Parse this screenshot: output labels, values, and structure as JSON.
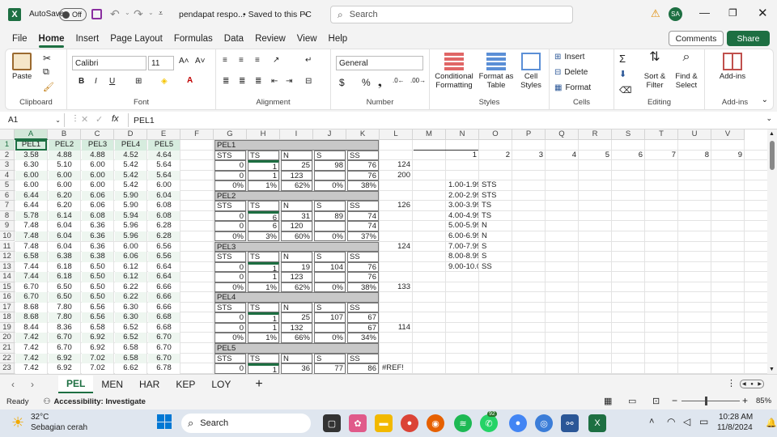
{
  "titlebar": {
    "autosave_label": "AutoSave",
    "autosave_state": "Off",
    "filename": "pendapat respo...",
    "saved_status": "• Saved to this PC",
    "search_placeholder": "Search",
    "user_initials": "SA"
  },
  "ribbon_tabs": [
    "File",
    "Home",
    "Insert",
    "Page Layout",
    "Formulas",
    "Data",
    "Review",
    "View",
    "Help"
  ],
  "ribbon_buttons": {
    "comments": "Comments",
    "share": "Share"
  },
  "ribbon": {
    "clipboard": {
      "paste": "Paste",
      "label": "Clipboard"
    },
    "font": {
      "name": "Calibri",
      "size": "11",
      "label": "Font"
    },
    "alignment": {
      "label": "Alignment"
    },
    "number": {
      "format": "General",
      "label": "Number"
    },
    "styles": {
      "cond": "Conditional Formatting",
      "table": "Format as Table",
      "cell": "Cell Styles",
      "label": "Styles"
    },
    "cells": {
      "insert": "Insert",
      "delete": "Delete",
      "format": "Format",
      "label": "Cells"
    },
    "editing": {
      "sort": "Sort & Filter",
      "find": "Find & Select",
      "label": "Editing"
    },
    "addins": {
      "btn": "Add-ins",
      "label": "Add-ins"
    }
  },
  "formula_bar": {
    "name_box": "A1",
    "fx": "fx",
    "content": "PEL1"
  },
  "columns": [
    "A",
    "B",
    "C",
    "D",
    "E",
    "F",
    "G",
    "H",
    "I",
    "J",
    "K",
    "L",
    "M",
    "N",
    "O",
    "P",
    "Q",
    "R",
    "S",
    "T",
    "U",
    "V"
  ],
  "rows": [
    "1",
    "2",
    "3",
    "4",
    "5",
    "6",
    "7",
    "8",
    "9",
    "10",
    "11",
    "12",
    "13",
    "14",
    "15",
    "16",
    "17",
    "18",
    "19",
    "20",
    "21",
    "22",
    "23"
  ],
  "table_left": {
    "headers": [
      "PEL1",
      "PEL2",
      "PEL3",
      "PEL4",
      "PEL5"
    ],
    "data": [
      [
        "3.58",
        "4.88",
        "4.88",
        "4.52",
        "4.64"
      ],
      [
        "6.30",
        "5.10",
        "6.00",
        "5.42",
        "5.64"
      ],
      [
        "6.00",
        "6.00",
        "6.00",
        "5.42",
        "5.64"
      ],
      [
        "6.00",
        "6.00",
        "6.00",
        "5.42",
        "6.00"
      ],
      [
        "6.44",
        "6.20",
        "6.06",
        "5.90",
        "6.04"
      ],
      [
        "6.44",
        "6.20",
        "6.06",
        "5.90",
        "6.08"
      ],
      [
        "5.78",
        "6.14",
        "6.08",
        "5.94",
        "6.08"
      ],
      [
        "7.48",
        "6.04",
        "6.36",
        "5.96",
        "6.28"
      ],
      [
        "7.48",
        "6.04",
        "6.36",
        "5.96",
        "6.28"
      ],
      [
        "7.48",
        "6.04",
        "6.36",
        "6.00",
        "6.56"
      ],
      [
        "6.58",
        "6.38",
        "6.38",
        "6.06",
        "6.56"
      ],
      [
        "7.44",
        "6.18",
        "6.50",
        "6.12",
        "6.64"
      ],
      [
        "7.44",
        "6.18",
        "6.50",
        "6.12",
        "6.64"
      ],
      [
        "6.70",
        "6.50",
        "6.50",
        "6.22",
        "6.66"
      ],
      [
        "6.70",
        "6.50",
        "6.50",
        "6.22",
        "6.66"
      ],
      [
        "8.68",
        "7.80",
        "6.56",
        "6.30",
        "6.66"
      ],
      [
        "8.68",
        "7.80",
        "6.56",
        "6.30",
        "6.68"
      ],
      [
        "8.44",
        "8.36",
        "6.58",
        "6.52",
        "6.68"
      ],
      [
        "7.42",
        "6.70",
        "6.92",
        "6.52",
        "6.70"
      ],
      [
        "7.42",
        "6.70",
        "6.92",
        "6.58",
        "6.70"
      ],
      [
        "7.42",
        "6.92",
        "7.02",
        "6.58",
        "6.70"
      ],
      [
        "7.42",
        "6.92",
        "7.02",
        "6.62",
        "6.78"
      ]
    ]
  },
  "blocks": [
    {
      "title": "PEL1",
      "labels": [
        "STS",
        "TS",
        "N",
        "S",
        "SS"
      ],
      "r1": [
        "0",
        "1",
        "25",
        "98",
        "76"
      ],
      "r2": [
        "0",
        "1",
        "123",
        "",
        "76"
      ],
      "pct": [
        "0%",
        "1%",
        "62%",
        "0%",
        "38%"
      ]
    },
    {
      "title": "PEL2",
      "labels": [
        "STS",
        "TS",
        "N",
        "S",
        "SS"
      ],
      "r1": [
        "0",
        "6",
        "31",
        "89",
        "74"
      ],
      "r2": [
        "0",
        "6",
        "120",
        "",
        "74"
      ],
      "pct": [
        "0%",
        "3%",
        "60%",
        "0%",
        "37%"
      ]
    },
    {
      "title": "PEL3",
      "labels": [
        "STS",
        "TS",
        "N",
        "S",
        "SS"
      ],
      "r1": [
        "0",
        "1",
        "19",
        "104",
        "76"
      ],
      "r2": [
        "0",
        "1",
        "123",
        "",
        "76"
      ],
      "pct": [
        "0%",
        "1%",
        "62%",
        "0%",
        "38%"
      ]
    },
    {
      "title": "PEL4",
      "labels": [
        "STS",
        "TS",
        "N",
        "S",
        "SS"
      ],
      "r1": [
        "0",
        "1",
        "25",
        "107",
        "67"
      ],
      "r2": [
        "0",
        "1",
        "132",
        "",
        "67"
      ],
      "pct": [
        "0%",
        "1%",
        "66%",
        "0%",
        "34%"
      ]
    },
    {
      "title": "PEL5",
      "labels": [
        "STS",
        "TS",
        "N",
        "S",
        "SS"
      ],
      "r1": [
        "0",
        "1",
        "36",
        "77",
        "86"
      ]
    }
  ],
  "col_l": [
    {
      "row": "3",
      "value": "124"
    },
    {
      "row": "4",
      "value": "200"
    },
    {
      "row": "7",
      "value": "126"
    },
    {
      "row": "11",
      "value": "124"
    },
    {
      "row": "15",
      "value": "133"
    },
    {
      "row": "19",
      "value": "114"
    },
    {
      "row": "23",
      "value": "#REF!"
    }
  ],
  "numbers_row": [
    "1",
    "2",
    "3",
    "4",
    "5",
    "6",
    "7",
    "8",
    "9"
  ],
  "legend": [
    [
      "1.00-1.99",
      "STS"
    ],
    [
      "2.00-2.99",
      "STS"
    ],
    [
      "3.00-3.99",
      "TS"
    ],
    [
      "4.00-4.99",
      "TS"
    ],
    [
      "5.00-5.99",
      "N"
    ],
    [
      "6.00-6.99",
      "N"
    ],
    [
      "7.00-7.99",
      "S"
    ],
    [
      "8.00-8.99",
      "S"
    ],
    [
      "9.00-10.00",
      "SS"
    ]
  ],
  "sheet_tabs": [
    "PEL",
    "MEN",
    "HAR",
    "KEP",
    "LOY"
  ],
  "status": {
    "ready": "Ready",
    "accessibility": "Accessibility: Investigate",
    "zoom": "85%"
  },
  "taskbar": {
    "temp": "32°C",
    "weather": "Sebagian cerah",
    "search": "Search",
    "time": "10:28 AM",
    "date": "11/8/2024",
    "badge": "92"
  }
}
